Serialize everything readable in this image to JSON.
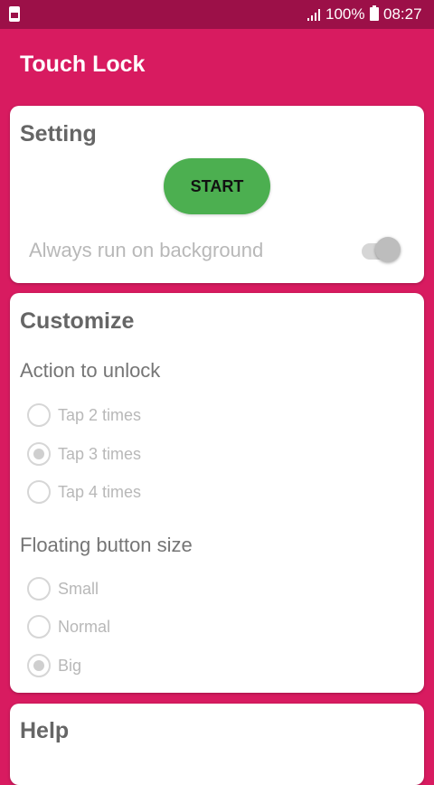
{
  "status_bar": {
    "battery_text": "100%",
    "time": "08:27",
    "icons": [
      "app-notification-icon",
      "signal-icon",
      "battery-icon"
    ]
  },
  "app_bar": {
    "title": "Touch Lock"
  },
  "setting": {
    "title": "Setting",
    "start_label": "START",
    "always_run_label": "Always run on background",
    "always_run_enabled": false
  },
  "customize": {
    "title": "Customize",
    "action_to_unlock": {
      "label": "Action to unlock",
      "options": [
        "Tap 2 times",
        "Tap 3 times",
        "Tap 4 times"
      ],
      "selected": "Tap 3 times"
    },
    "floating_button_size": {
      "label": "Floating button size",
      "options": [
        "Small",
        "Normal",
        "Big"
      ],
      "selected": "Big"
    }
  },
  "help": {
    "title": "Help"
  },
  "colors": {
    "primary": "#d81b60",
    "status_bar": "#9c1048",
    "start_button": "#4caf50"
  }
}
